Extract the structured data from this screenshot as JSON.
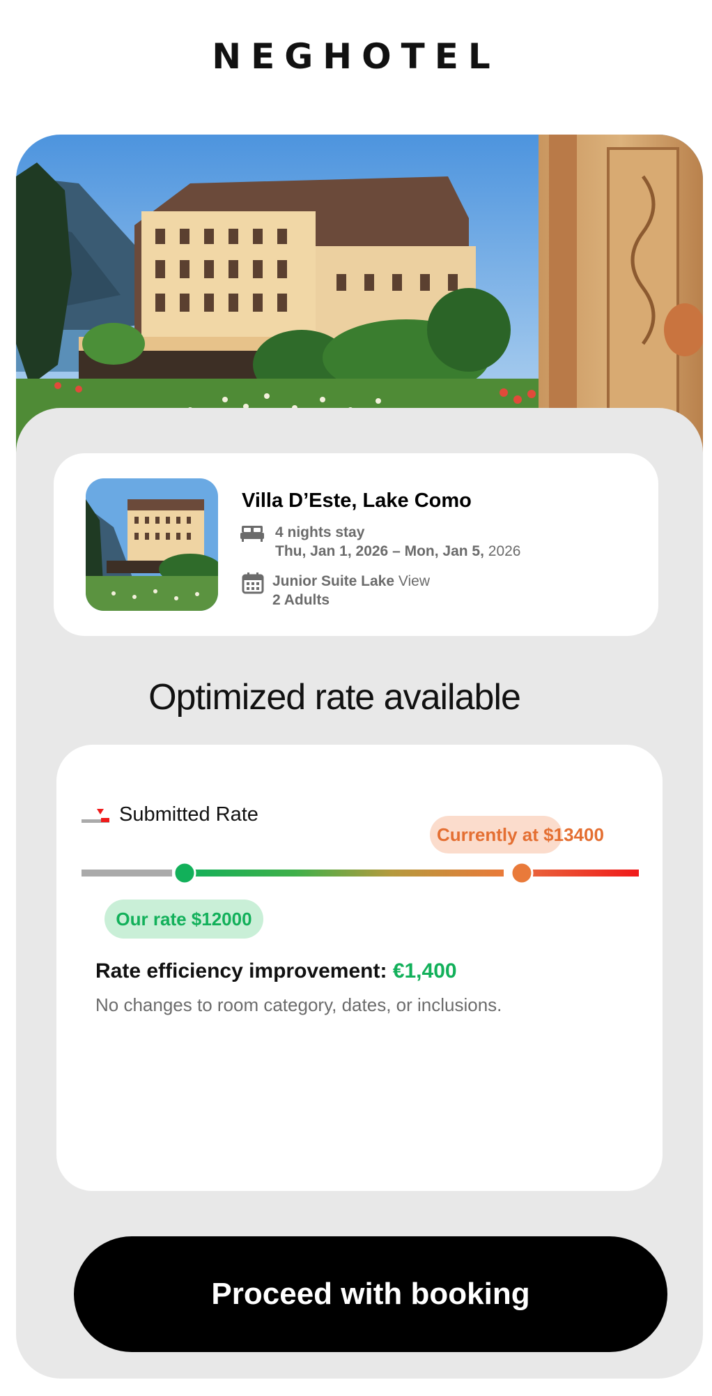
{
  "brand": {
    "logo_text": "NEGHOTEL"
  },
  "hero": {
    "image": "lake-hotel-villa-photo"
  },
  "booking": {
    "hotel_name": "Villa D’Este, Lake Como",
    "nights": "4 nights stay",
    "dates_bold": "Thu, Jan 1, 2026 – Mon, Jan 5,",
    "dates_year": " 2026",
    "room_bold": "Junior Suite Lake",
    "room_rest": " View",
    "guests": "2 Adults",
    "icons": {
      "stay": "bed-icon",
      "room": "calendar-icon"
    }
  },
  "rate": {
    "title": "Optimized rate available",
    "submitted_label": "Submitted Rate",
    "current_label": "Currently at $13400",
    "our_rate_label": "Our rate $12000",
    "improvement_label": "Rate efficiency improvement:",
    "improvement_value": "€1,400",
    "note": "No changes to room category, dates, or inclusions.",
    "our_rate": 12000,
    "current_rate": 13400,
    "colors": {
      "green": "#12b05a",
      "orange": "#e97a3a",
      "red": "#f01a1a",
      "gray": "#aaaaaa"
    }
  },
  "cta": {
    "label": "Proceed with booking"
  }
}
